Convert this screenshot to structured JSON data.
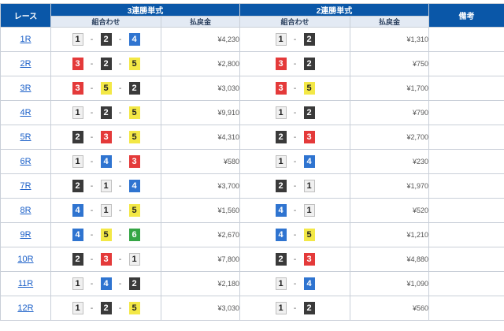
{
  "headers": {
    "race": "レース",
    "trifecta": "3連勝単式",
    "exacta": "2連勝単式",
    "notes": "備考",
    "combination": "組合わせ",
    "payout": "払戻金"
  },
  "separator": "-",
  "boat_colors": {
    "1": "#f0f0f0",
    "2": "#3a3a3a",
    "3": "#e43a3a",
    "4": "#2f74d0",
    "5": "#f3e846",
    "6": "#35a545"
  },
  "rows": [
    {
      "race": "1R",
      "tri": [
        "1",
        "2",
        "4"
      ],
      "tri_payout": "¥4,230",
      "exa": [
        "1",
        "2"
      ],
      "exa_payout": "¥1,310"
    },
    {
      "race": "2R",
      "tri": [
        "3",
        "2",
        "5"
      ],
      "tri_payout": "¥2,800",
      "exa": [
        "3",
        "2"
      ],
      "exa_payout": "¥750"
    },
    {
      "race": "3R",
      "tri": [
        "3",
        "5",
        "2"
      ],
      "tri_payout": "¥3,030",
      "exa": [
        "3",
        "5"
      ],
      "exa_payout": "¥1,700"
    },
    {
      "race": "4R",
      "tri": [
        "1",
        "2",
        "5"
      ],
      "tri_payout": "¥9,910",
      "exa": [
        "1",
        "2"
      ],
      "exa_payout": "¥790"
    },
    {
      "race": "5R",
      "tri": [
        "2",
        "3",
        "5"
      ],
      "tri_payout": "¥4,310",
      "exa": [
        "2",
        "3"
      ],
      "exa_payout": "¥2,700"
    },
    {
      "race": "6R",
      "tri": [
        "1",
        "4",
        "3"
      ],
      "tri_payout": "¥580",
      "exa": [
        "1",
        "4"
      ],
      "exa_payout": "¥230"
    },
    {
      "race": "7R",
      "tri": [
        "2",
        "1",
        "4"
      ],
      "tri_payout": "¥3,700",
      "exa": [
        "2",
        "1"
      ],
      "exa_payout": "¥1,970"
    },
    {
      "race": "8R",
      "tri": [
        "4",
        "1",
        "5"
      ],
      "tri_payout": "¥1,560",
      "exa": [
        "4",
        "1"
      ],
      "exa_payout": "¥520"
    },
    {
      "race": "9R",
      "tri": [
        "4",
        "5",
        "6"
      ],
      "tri_payout": "¥2,670",
      "exa": [
        "4",
        "5"
      ],
      "exa_payout": "¥1,210"
    },
    {
      "race": "10R",
      "tri": [
        "2",
        "3",
        "1"
      ],
      "tri_payout": "¥7,800",
      "exa": [
        "2",
        "3"
      ],
      "exa_payout": "¥4,880"
    },
    {
      "race": "11R",
      "tri": [
        "1",
        "4",
        "2"
      ],
      "tri_payout": "¥2,180",
      "exa": [
        "1",
        "4"
      ],
      "exa_payout": "¥1,090"
    },
    {
      "race": "12R",
      "tri": [
        "1",
        "2",
        "5"
      ],
      "tri_payout": "¥3,030",
      "exa": [
        "1",
        "2"
      ],
      "exa_payout": "¥560"
    }
  ]
}
